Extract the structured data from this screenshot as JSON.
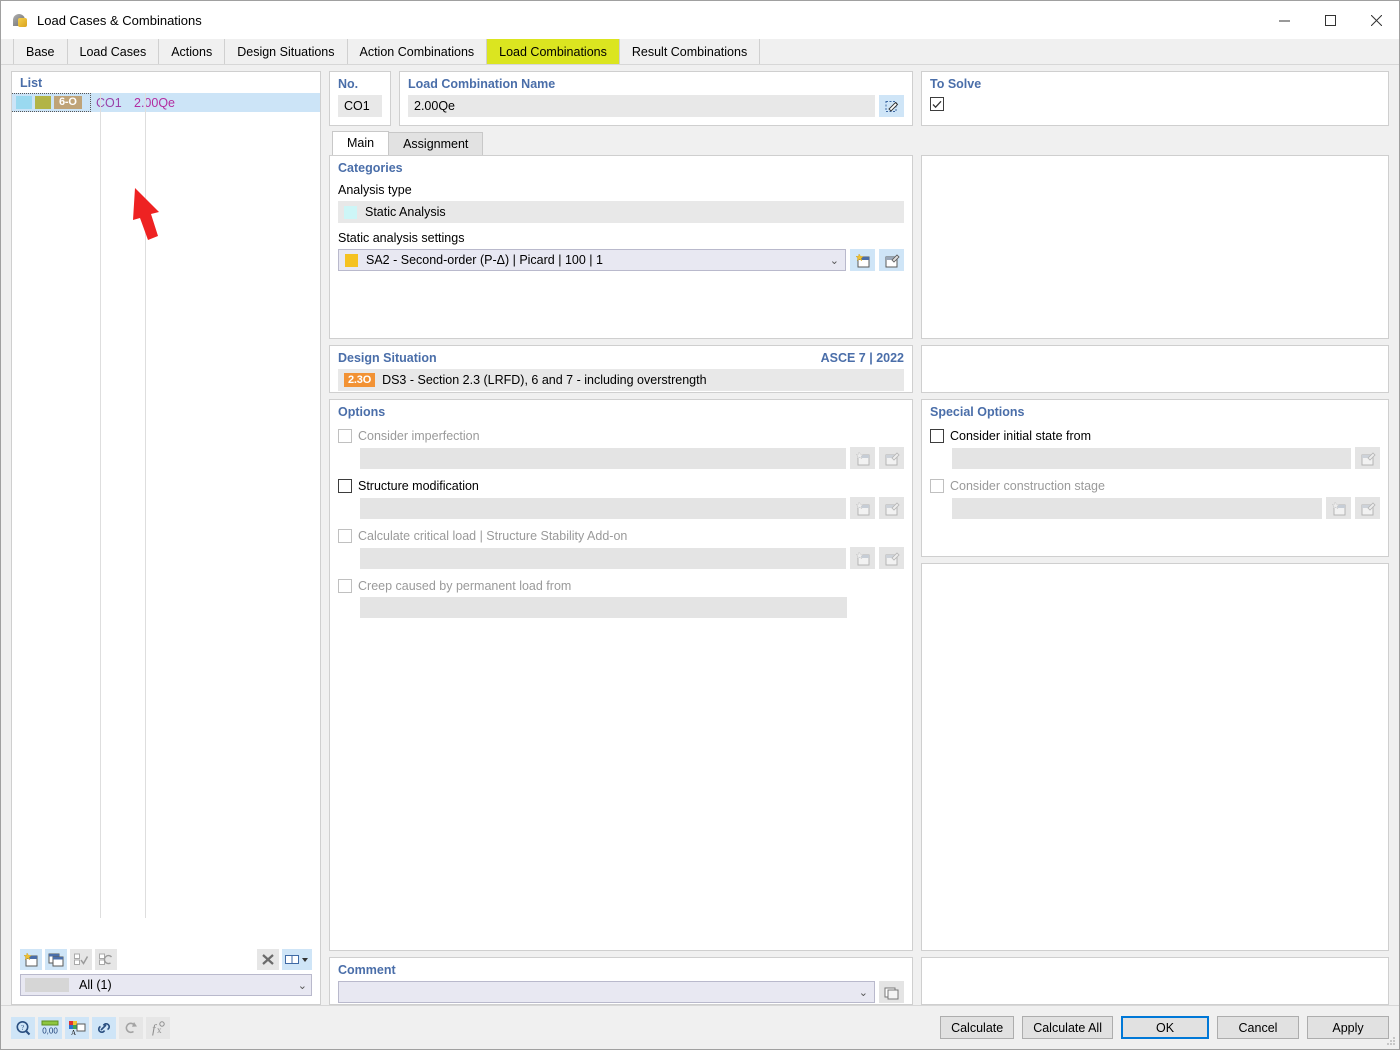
{
  "window": {
    "title": "Load Cases & Combinations",
    "icon": "app-icon",
    "minimize": "–",
    "maximize": "□",
    "close": "✕"
  },
  "tabs": [
    {
      "label": "Base",
      "active": false
    },
    {
      "label": "Load Cases",
      "active": false
    },
    {
      "label": "Actions",
      "active": false
    },
    {
      "label": "Design Situations",
      "active": false
    },
    {
      "label": "Action Combinations",
      "active": false
    },
    {
      "label": "Load Combinations",
      "active": true
    },
    {
      "label": "Result Combinations",
      "active": false
    }
  ],
  "list": {
    "title": "List",
    "rows": [
      {
        "badge": "6-O",
        "no": "CO1",
        "name": "2.00Qe",
        "selected": true
      }
    ],
    "toolbar": [
      "new-icon",
      "copy-icon",
      "check-all-icon",
      "invert-selection-icon",
      "delete-icon",
      "columns-icon"
    ],
    "filter": {
      "value": "All (1)"
    }
  },
  "header": {
    "no_label": "No.",
    "no_value": "CO1",
    "name_label": "Load Combination Name",
    "name_value": "2.00Qe",
    "edit_icon": "edit-name-icon",
    "to_solve_label": "To Solve",
    "to_solve_checked": true
  },
  "inner_tabs": [
    {
      "label": "Main",
      "active": true
    },
    {
      "label": "Assignment",
      "active": false
    }
  ],
  "categories": {
    "title": "Categories",
    "analysis_type_label": "Analysis type",
    "analysis_type_value": "Static Analysis",
    "settings_label": "Static analysis settings",
    "settings_value": "SA2 - Second-order (P-Δ) | Picard | 100 | 1",
    "settings_color": "#f5c220",
    "new_icon": "new-settings-icon",
    "edit_icon": "edit-settings-icon"
  },
  "design_situation": {
    "title": "Design Situation",
    "standard": "ASCE 7 | 2022",
    "badge": "2.3O",
    "badge_color": "#f29234",
    "value": "DS3 - Section 2.3 (LRFD), 6 and 7 - including overstrength"
  },
  "options": {
    "title": "Options",
    "items": [
      {
        "label": "Consider imperfection",
        "checked": false,
        "enabled": false,
        "has_field": true,
        "field_value": "",
        "buttons": [
          "new-icon",
          "edit-icon"
        ]
      },
      {
        "label": "Structure modification",
        "checked": false,
        "enabled": true,
        "has_field": true,
        "field_value": "",
        "buttons": [
          "new-icon",
          "edit-icon"
        ]
      },
      {
        "label": "Calculate critical load | Structure Stability Add-on",
        "checked": false,
        "enabled": false,
        "has_field": true,
        "field_value": "",
        "buttons": [
          "new-icon",
          "edit-icon"
        ]
      },
      {
        "label": "Creep caused by permanent load from",
        "checked": false,
        "enabled": false,
        "has_field": true,
        "field_value": "",
        "buttons": []
      }
    ]
  },
  "special_options": {
    "title": "Special Options",
    "items": [
      {
        "label": "Consider initial state from",
        "checked": false,
        "enabled": true,
        "has_field": true,
        "field_value": "",
        "buttons": [
          "edit-icon"
        ]
      },
      {
        "label": "Consider construction stage",
        "checked": false,
        "enabled": false,
        "has_field": true,
        "field_value": "",
        "buttons": [
          "new-icon",
          "edit-icon"
        ]
      }
    ]
  },
  "comment": {
    "title": "Comment",
    "value": "",
    "button": "comment-library-icon"
  },
  "footer": {
    "tools": [
      "info-icon",
      "units-icon",
      "colors-icon",
      "link-icon",
      "refresh-icon",
      "formula-icon"
    ],
    "buttons": [
      {
        "label": "Calculate",
        "primary": false
      },
      {
        "label": "Calculate All",
        "primary": false
      },
      {
        "label": "OK",
        "primary": true
      },
      {
        "label": "Cancel",
        "primary": false
      },
      {
        "label": "Apply",
        "primary": false
      }
    ]
  },
  "annotation": {
    "type": "red-arrow",
    "color": "#ee2222"
  },
  "colors": {
    "accent_tab": "#dbe520",
    "label_blue": "#4a6ea9",
    "selection": "#cce4f7",
    "primary_border": "#0078d7"
  }
}
